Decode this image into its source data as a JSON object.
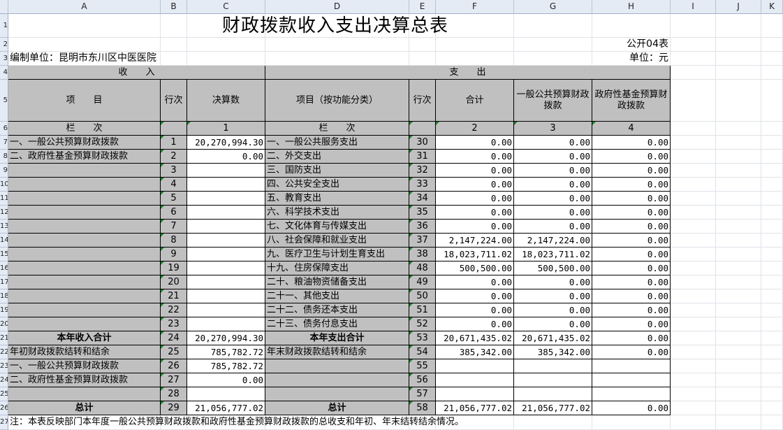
{
  "columns": [
    "A",
    "B",
    "C",
    "D",
    "E",
    "F",
    "G",
    "H",
    "I",
    "J",
    "K"
  ],
  "row_numbers": [
    "1",
    "2",
    "3",
    "4",
    "5",
    "6",
    "7",
    "8",
    "9",
    "10",
    "11",
    "12",
    "13",
    "14",
    "15",
    "16",
    "17",
    "18",
    "19",
    "20",
    "21",
    "22",
    "23",
    "24",
    "25",
    "26",
    "27"
  ],
  "title": "财政拨款收入支出决算总表",
  "form_no": "公开04表",
  "unit_label": "编制单位：昆明市东川区中医医院",
  "currency": "单位：元",
  "income_header": "收　　入",
  "expense_header": "支　　出",
  "headers": {
    "item": "项　　目",
    "line_no": "行次",
    "actual": "决算数",
    "func_item": "项目（按功能分类）",
    "line_no2": "行次",
    "total": "合计",
    "general_budget": "一般公共预算财政拨款",
    "gov_fund": "政府性基金预算财政拨款"
  },
  "col_index": {
    "label_left": "栏　　次",
    "c1": "1",
    "label_right": "栏　　次",
    "c2": "2",
    "c3": "3",
    "c4": "4"
  },
  "rows": [
    {
      "in_item": "一、一般公共预算财政拨款",
      "in_line": "1",
      "in_val": "20,270,994.30",
      "ex_item": "一、一般公共服务支出",
      "ex_line": "30",
      "total": "0.00",
      "gen": "0.00",
      "fund": "0.00"
    },
    {
      "in_item": "二、政府性基金预算财政拨款",
      "in_line": "2",
      "in_val": "0.00",
      "ex_item": "二、外交支出",
      "ex_line": "31",
      "total": "0.00",
      "gen": "0.00",
      "fund": "0.00"
    },
    {
      "in_item": "",
      "in_line": "3",
      "in_val": "",
      "ex_item": "三、国防支出",
      "ex_line": "32",
      "total": "0.00",
      "gen": "0.00",
      "fund": "0.00"
    },
    {
      "in_item": "",
      "in_line": "4",
      "in_val": "",
      "ex_item": "四、公共安全支出",
      "ex_line": "33",
      "total": "0.00",
      "gen": "0.00",
      "fund": "0.00"
    },
    {
      "in_item": "",
      "in_line": "5",
      "in_val": "",
      "ex_item": "五、教育支出",
      "ex_line": "34",
      "total": "0.00",
      "gen": "0.00",
      "fund": "0.00"
    },
    {
      "in_item": "",
      "in_line": "6",
      "in_val": "",
      "ex_item": "六、科学技术支出",
      "ex_line": "35",
      "total": "0.00",
      "gen": "0.00",
      "fund": "0.00"
    },
    {
      "in_item": "",
      "in_line": "7",
      "in_val": "",
      "ex_item": "七、文化体育与传媒支出",
      "ex_line": "36",
      "total": "0.00",
      "gen": "0.00",
      "fund": "0.00"
    },
    {
      "in_item": "",
      "in_line": "8",
      "in_val": "",
      "ex_item": "八、社会保障和就业支出",
      "ex_line": "37",
      "total": "2,147,224.00",
      "gen": "2,147,224.00",
      "fund": "0.00"
    },
    {
      "in_item": "",
      "in_line": "9",
      "in_val": "",
      "ex_item": "九、医疗卫生与计划生育支出",
      "ex_line": "38",
      "total": "18,023,711.02",
      "gen": "18,023,711.02",
      "fund": "0.00"
    },
    {
      "in_item": "",
      "in_line": "19",
      "in_val": "",
      "ex_item": "十九、住房保障支出",
      "ex_line": "48",
      "total": "500,500.00",
      "gen": "500,500.00",
      "fund": "0.00"
    },
    {
      "in_item": "",
      "in_line": "20",
      "in_val": "",
      "ex_item": "二十、粮油物资储备支出",
      "ex_line": "49",
      "total": "0.00",
      "gen": "0.00",
      "fund": "0.00"
    },
    {
      "in_item": "",
      "in_line": "21",
      "in_val": "",
      "ex_item": "二十一、其他支出",
      "ex_line": "50",
      "total": "0.00",
      "gen": "0.00",
      "fund": "0.00"
    },
    {
      "in_item": "",
      "in_line": "22",
      "in_val": "",
      "ex_item": "二十二、债务还本支出",
      "ex_line": "51",
      "total": "0.00",
      "gen": "0.00",
      "fund": "0.00"
    },
    {
      "in_item": "",
      "in_line": "23",
      "in_val": "",
      "ex_item": "二十三、债务付息支出",
      "ex_line": "52",
      "total": "0.00",
      "gen": "0.00",
      "fund": "0.00"
    },
    {
      "in_item": "本年收入合计",
      "in_line": "24",
      "in_val": "20,270,994.30",
      "ex_item": "本年支出合计",
      "ex_line": "53",
      "total": "20,671,435.02",
      "gen": "20,671,435.02",
      "fund": "0.00"
    },
    {
      "in_item": "年初财政拨款结转和结余",
      "in_line": "25",
      "in_val": "785,782.72",
      "ex_item": "年末财政拨款结转和结余",
      "ex_line": "54",
      "total": "385,342.00",
      "gen": "385,342.00",
      "fund": "0.00"
    },
    {
      "in_item": "一、一般公共预算财政拨款",
      "in_line": "26",
      "in_val": "785,782.72",
      "ex_item": "",
      "ex_line": "55",
      "total": "",
      "gen": "",
      "fund": ""
    },
    {
      "in_item": "二、政府性基金预算财政拨款",
      "in_line": "27",
      "in_val": "0.00",
      "ex_item": "",
      "ex_line": "56",
      "total": "",
      "gen": "",
      "fund": ""
    },
    {
      "in_item": "",
      "in_line": "28",
      "in_val": "",
      "ex_item": "",
      "ex_line": "57",
      "total": "",
      "gen": "",
      "fund": ""
    },
    {
      "in_item": "总计",
      "in_line": "29",
      "in_val": "21,056,777.02",
      "ex_item": "总计",
      "ex_line": "58",
      "total": "21,056,777.02",
      "gen": "21,056,777.02",
      "fund": "0.00"
    }
  ],
  "note": "注：本表反映部门本年度一般公共预算财政拨款和政府性基金预算财政拨款的总收支和年初、年末结转结余情况。"
}
